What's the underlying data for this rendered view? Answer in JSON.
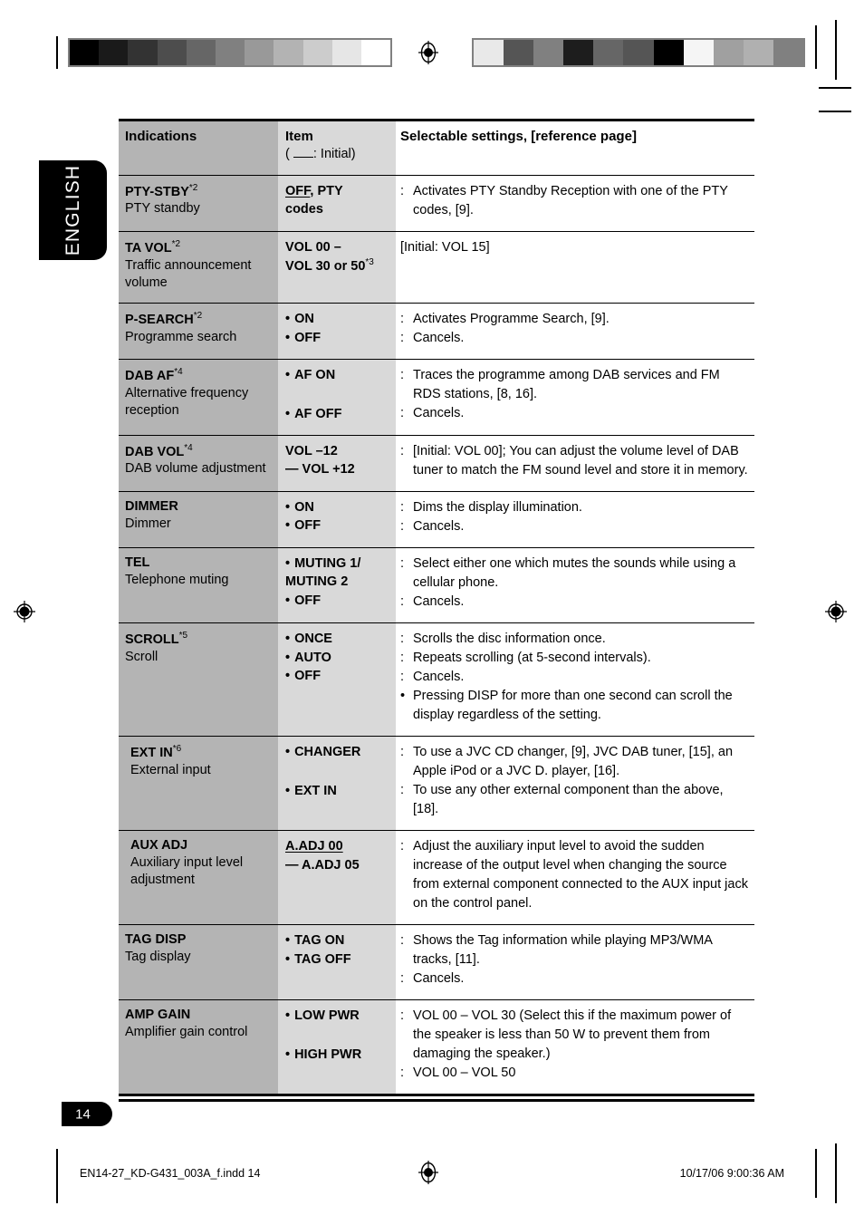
{
  "language_tab": "ENGLISH",
  "page_number": "14",
  "footer": {
    "file": "EN14-27_KD-G431_003A_f.indd   14",
    "date": "10/17/06   9:00:36 AM"
  },
  "colors": {
    "col1_bg": "#b4b4b4",
    "col2_bg": "#d9d9d9",
    "col3_bg": "#ffffff",
    "border": "#000000",
    "tab_bg": "#000000"
  },
  "colorbars": {
    "left": [
      "#000000",
      "#1a1a1a",
      "#333333",
      "#4d4d4d",
      "#666666",
      "#808080",
      "#999999",
      "#b3b3b3",
      "#cccccc",
      "#e6e6e6",
      "#ffffff"
    ],
    "right": [
      "#e9e9e9",
      "#555555",
      "#808080",
      "#1d1d1d",
      "#666666",
      "#555555",
      "#000000",
      "#f5f5f5",
      "#a0a0a0",
      "#b0b0b0",
      "#808080"
    ]
  },
  "table": {
    "headers": {
      "col1": "Indications",
      "col2_line1": "Item",
      "col2_line2_pre": "(",
      "col2_line2_post": ": Initial)",
      "col3": "Selectable settings, [reference page]"
    },
    "rows": [
      {
        "name": "PTY-STBY",
        "name_sup": "*2",
        "desc": "PTY standby",
        "items": [
          {
            "bullet": false,
            "text_html": "OFF, PTY",
            "underline_part": "OFF"
          },
          {
            "bullet": false,
            "text_html": "codes"
          }
        ],
        "settings": [
          {
            "lead": ":",
            "text": "Activates PTY Standby Reception with one of the PTY codes, [9]."
          }
        ]
      },
      {
        "name": "TA VOL",
        "name_sup": "*2",
        "desc": "Traffic announcement volume",
        "items": [
          {
            "bullet": false,
            "text_html": "VOL 00 –"
          },
          {
            "bullet": false,
            "text_html": "VOL 30 or 50",
            "sup": "*3"
          }
        ],
        "settings": [
          {
            "lead": "",
            "text": "[Initial: VOL 15]"
          }
        ]
      },
      {
        "name": "P-SEARCH",
        "name_sup": "*2",
        "desc": "Programme search",
        "items": [
          {
            "bullet": true,
            "text_html": "ON"
          },
          {
            "bullet": true,
            "text_html": "OFF",
            "underline_part": "OFF"
          }
        ],
        "settings": [
          {
            "lead": ":",
            "text": "Activates Programme Search, [9]."
          },
          {
            "lead": ":",
            "text": "Cancels."
          }
        ]
      },
      {
        "name": "DAB AF",
        "name_sup": "*4",
        "desc": "Alternative frequency reception",
        "items": [
          {
            "bullet": true,
            "text_html": "AF ON",
            "underline_part": "AF ON"
          },
          {
            "bullet": true,
            "text_html": "AF OFF",
            "gap_before": true
          }
        ],
        "settings": [
          {
            "lead": ":",
            "text": "Traces the programme among DAB services and FM RDS stations, [8, 16]."
          },
          {
            "lead": ":",
            "text": "Cancels."
          }
        ]
      },
      {
        "name": "DAB VOL",
        "name_sup": "*4",
        "desc": "DAB volume adjustment",
        "items": [
          {
            "bullet": false,
            "text_html": "VOL –12"
          },
          {
            "bullet": false,
            "text_html": "— VOL +12"
          }
        ],
        "settings": [
          {
            "lead": ":",
            "text": "[Initial: VOL 00]; You can adjust the volume level of DAB tuner to match the FM sound level and store it in memory."
          }
        ]
      },
      {
        "name": "DIMMER",
        "name_sup": "",
        "desc": "Dimmer",
        "items": [
          {
            "bullet": true,
            "text_html": "ON"
          },
          {
            "bullet": true,
            "text_html": "OFF",
            "underline_part": "OFF"
          }
        ],
        "settings": [
          {
            "lead": ":",
            "text": "Dims the display illumination."
          },
          {
            "lead": ":",
            "text": "Cancels."
          }
        ]
      },
      {
        "name": "TEL",
        "name_sup": "",
        "desc": "Telephone muting",
        "items": [
          {
            "bullet": true,
            "text_html": "MUTING 1/"
          },
          {
            "bullet": false,
            "text_html": "MUTING 2"
          },
          {
            "bullet": true,
            "text_html": "OFF",
            "underline_part": "OFF"
          }
        ],
        "settings": [
          {
            "lead": ":",
            "text": "Select either one which mutes the sounds while using a cellular phone."
          },
          {
            "lead": ":",
            "text": "Cancels."
          }
        ]
      },
      {
        "name": "SCROLL",
        "name_sup": "*5",
        "desc": "Scroll",
        "items": [
          {
            "bullet": true,
            "text_html": "ONCE",
            "underline_part": "ONCE"
          },
          {
            "bullet": true,
            "text_html": "AUTO"
          },
          {
            "bullet": true,
            "text_html": "OFF"
          }
        ],
        "settings": [
          {
            "lead": ":",
            "text": "Scrolls the disc information once."
          },
          {
            "lead": ":",
            "text": "Repeats scrolling (at 5-second intervals)."
          },
          {
            "lead": ":",
            "text": "Cancels."
          },
          {
            "lead": "•",
            "text": "Pressing DISP for more than one second can scroll the display regardless of the setting."
          }
        ]
      },
      {
        "name": "EXT IN",
        "name_sup": "*6",
        "desc": "External input",
        "indented": true,
        "items": [
          {
            "bullet": true,
            "text_html": "CHANGER",
            "underline_part": "CHANGER"
          },
          {
            "bullet": true,
            "text_html": "EXT IN",
            "gap_before": true
          }
        ],
        "settings": [
          {
            "lead": ":",
            "text": "To use a JVC CD changer, [9], JVC DAB tuner, [15], an Apple iPod or a JVC D. player, [16]."
          },
          {
            "lead": ":",
            "text": "To use any other external component than the above, [18]."
          }
        ]
      },
      {
        "name": "AUX ADJ",
        "name_sup": "",
        "desc": "Auxiliary input level adjustment",
        "indented": true,
        "items": [
          {
            "bullet": false,
            "text_html": "A.ADJ 00",
            "underline_part": "A.ADJ 00"
          },
          {
            "bullet": false,
            "text_html": "— A.ADJ 05"
          }
        ],
        "settings": [
          {
            "lead": ":",
            "text": "Adjust the auxiliary input level to avoid the sudden increase of the output level when changing the source from external component connected to the AUX input jack on the control panel."
          }
        ]
      },
      {
        "name": "TAG DISP",
        "name_sup": "",
        "desc": "Tag display",
        "items": [
          {
            "bullet": true,
            "text_html": "TAG ON",
            "underline_part": "TAG ON"
          },
          {
            "bullet": true,
            "text_html": "TAG OFF"
          }
        ],
        "settings": [
          {
            "lead": ":",
            "text": "Shows the Tag information while playing MP3/WMA tracks, [11]."
          },
          {
            "lead": ":",
            "text": "Cancels."
          }
        ]
      },
      {
        "name": "AMP GAIN",
        "name_sup": "",
        "desc": "Amplifier gain control",
        "items": [
          {
            "bullet": true,
            "text_html": "LOW PWR"
          },
          {
            "bullet": true,
            "text_html": "HIGH PWR",
            "underline_part": "HIGH PWR",
            "gap_before": true
          }
        ],
        "settings": [
          {
            "lead": ":",
            "text": "VOL 00 – VOL 30 (Select this if the maximum power of the speaker is less than 50 W to prevent them from damaging the speaker.)"
          },
          {
            "lead": ":",
            "text": "VOL 00 – VOL 50"
          }
        ]
      }
    ]
  }
}
